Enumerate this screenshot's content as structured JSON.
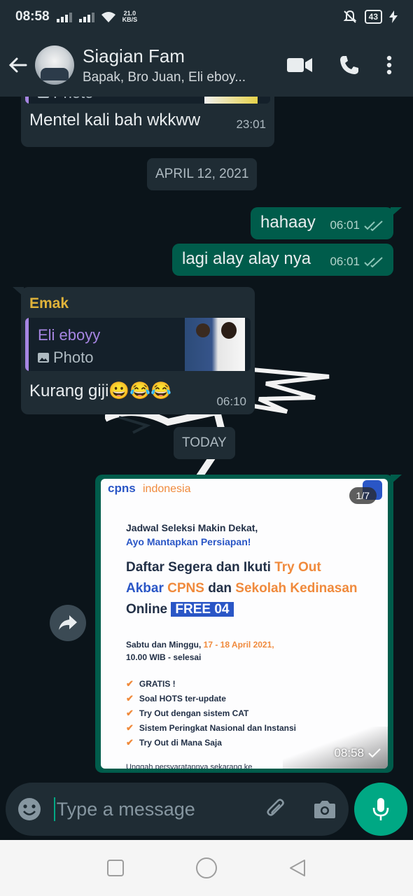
{
  "status": {
    "time": "08:58",
    "speed_value": "21.0",
    "speed_unit": "KB/S",
    "battery": "43"
  },
  "header": {
    "title": "Siagian Fam",
    "subtitle": "Bapak, Bro Juan, Eli eboy..."
  },
  "messages": [
    {
      "partial_label": "Photo",
      "text": "Mentel kali bah wkkww",
      "time": "23:01"
    },
    {
      "date": "APRIL 12, 2021"
    },
    {
      "text": "hahaay",
      "time": "06:01"
    },
    {
      "text": "lagi alay alay nya",
      "time": "06:01"
    },
    {
      "sender": "Emak",
      "quote_name": "Eli eboyy",
      "quote_label": "Photo",
      "text": "Kurang giji😀😂😂",
      "time": "06:10"
    },
    {
      "date": "TODAY"
    },
    {
      "time": "08:58",
      "counter": "1/7",
      "poster": {
        "brand_a": "cpns",
        "brand_b": "indonesia",
        "line1": "Jadwal Seleksi Makin Dekat,",
        "line2": "Ayo Mantapkan Persiapan!",
        "h1a": "Daftar Segera dan Ikuti ",
        "h1b": "Try Out",
        "h2a": "Akbar ",
        "h2b": "CPNS",
        "h2c": " dan ",
        "h2d": "Sekolah Kedinasan",
        "h3a": "Online ",
        "h3b": "FREE 04",
        "date_a": "Sabtu dan Minggu, ",
        "date_b": "17 - 18 April 2021,",
        "date_line2": "10.00 WIB - selesai",
        "items": [
          "GRATIS !",
          "Soal HOTS ter-update",
          "Try Out dengan sistem CAT",
          "Sistem Peringkat Nasional dan Instansi",
          "Try Out di Mana Saja"
        ],
        "footer": "Unggah persyaratannya sekarang ke"
      }
    }
  ],
  "composer": {
    "placeholder": "Type a message"
  },
  "colors": {
    "accent": "#00a884",
    "outgoing": "#005c4b",
    "incoming": "#1f2c34",
    "background": "#0b141a",
    "quote_name": "#a685e2",
    "sender_name": "#e0b33a"
  },
  "icons": [
    "back-arrow-icon",
    "video-call-icon",
    "voice-call-icon",
    "more-options-icon",
    "forward-icon",
    "emoji-icon",
    "attach-icon",
    "camera-icon",
    "mic-icon",
    "recents-icon",
    "home-icon",
    "back-nav-icon"
  ]
}
